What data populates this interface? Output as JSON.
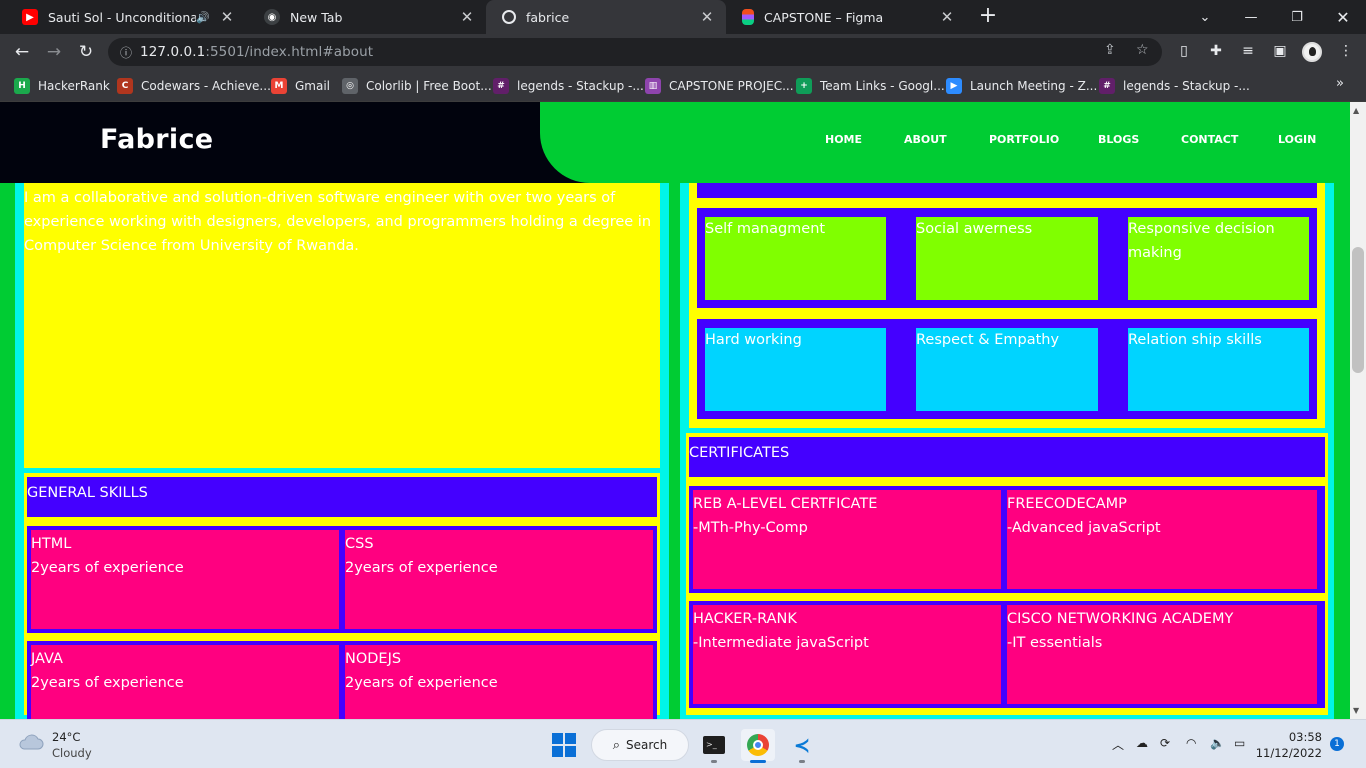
{
  "browser": {
    "tabs": [
      {
        "title": "Sauti Sol - Unconditionally B",
        "icon": "youtube-icon",
        "audio": true
      },
      {
        "title": "New Tab",
        "icon": "chrome-icon"
      },
      {
        "title": "fabrice",
        "icon": "globe-icon",
        "active": true
      },
      {
        "title": "CAPSTONE – Figma",
        "icon": "figma-icon"
      }
    ],
    "url_host": "127.0.0.1",
    "url_rest": ":5501/index.html#about",
    "bookmarks": [
      {
        "label": "HackerRank",
        "icon": "hackerrank-icon",
        "color": "#1ba94c",
        "glyph": "H"
      },
      {
        "label": "Codewars - Achieve...",
        "icon": "codewars-icon",
        "color": "#b1361e",
        "glyph": "C"
      },
      {
        "label": "Gmail",
        "icon": "gmail-icon",
        "color": "#ea4335",
        "glyph": "M"
      },
      {
        "label": "Colorlib | Free Boot...",
        "icon": "globe-icon",
        "color": "#5f6368",
        "glyph": "◎"
      },
      {
        "label": "legends - Stackup -...",
        "icon": "slack-icon",
        "color": "#611f69",
        "glyph": "#"
      },
      {
        "label": "CAPSTONE PROJEC...",
        "icon": "trello-icon",
        "color": "#8e44ad",
        "glyph": "▥"
      },
      {
        "label": "Team Links - Googl...",
        "icon": "google-sheets-icon",
        "color": "#0f9d58",
        "glyph": "+"
      },
      {
        "label": "Launch Meeting - Z...",
        "icon": "zoom-icon",
        "color": "#2d8cff",
        "glyph": "▶"
      },
      {
        "label": "legends - Stackup -...",
        "icon": "slack-icon",
        "color": "#611f69",
        "glyph": "#"
      }
    ]
  },
  "site": {
    "brand": "Fabrice",
    "nav": [
      "HOME",
      "ABOUT",
      "PORTFOLIO",
      "BLOGS",
      "CONTACT",
      "LOGIN"
    ],
    "about_text": "I am a collaborative and solution-driven software engineer with over two years of experience working with designers, developers, and programmers holding a degree in Computer Science from University of Rwanda.",
    "soft_skills_row1": [
      "Self managment",
      "Social awerness",
      "Responsive decision making"
    ],
    "soft_skills_row2": [
      "Hard working",
      "Respect & Empathy",
      "Relation ship skills"
    ],
    "general_skills": {
      "title": "GENERAL SKILLS",
      "items": [
        {
          "name": "HTML",
          "detail": "2years of experience"
        },
        {
          "name": "CSS",
          "detail": "2years of experience"
        },
        {
          "name": "JAVA",
          "detail": "2years of experience"
        },
        {
          "name": "NODEJS",
          "detail": "2years of experience"
        }
      ]
    },
    "certificates": {
      "title": "CERTIFICATES",
      "items": [
        {
          "name": "REB A-LEVEL CERTFICATE",
          "detail": "-MTh-Phy-Comp"
        },
        {
          "name": "FREECODECAMP",
          "detail": "-Advanced javaScript"
        },
        {
          "name": "HACKER-RANK",
          "detail": "-Intermediate javaScript"
        },
        {
          "name": "CISCO NETWORKING ACADEMY",
          "detail": "-IT essentials"
        }
      ]
    }
  },
  "taskbar": {
    "temperature": "24°C",
    "condition": "Cloudy",
    "search_label": "Search",
    "time": "03:58",
    "date": "11/12/2022",
    "notifications": "1"
  }
}
